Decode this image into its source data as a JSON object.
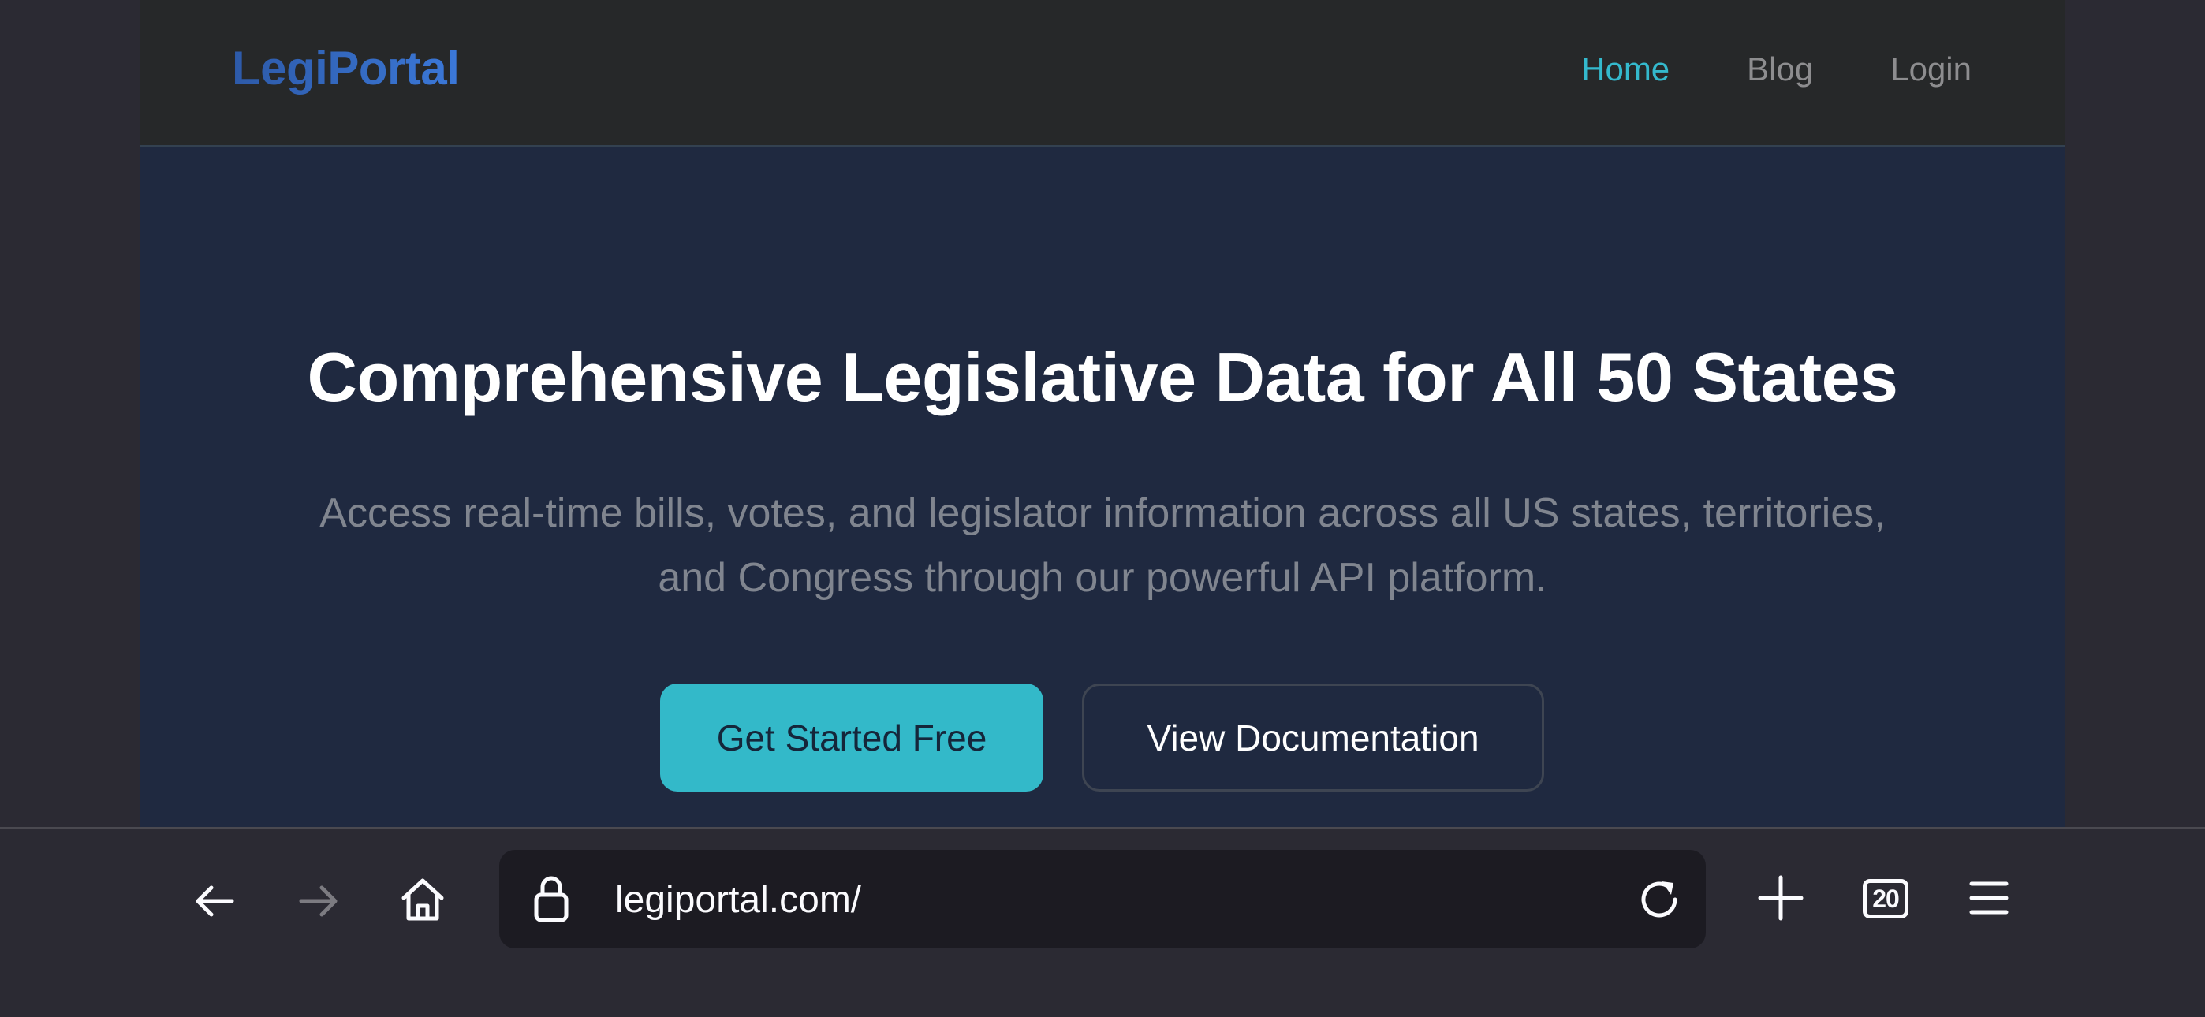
{
  "site": {
    "logo": "LegiPortal",
    "nav": [
      {
        "label": "Home",
        "active": true
      },
      {
        "label": "Blog",
        "active": false
      },
      {
        "label": "Login",
        "active": false
      }
    ]
  },
  "hero": {
    "title": "Comprehensive Legislative Data for All 50 States",
    "subtitle_line1": "Access real-time bills, votes, and legislator information across all US states, territories,",
    "subtitle_line2": "and Congress through our powerful API platform.",
    "primary_button": "Get Started Free",
    "secondary_button": "View Documentation"
  },
  "browser": {
    "url": "legiportal.com/",
    "tab_count": "20",
    "icons": [
      "back-icon",
      "forward-icon",
      "home-icon",
      "lock-icon",
      "reload-icon",
      "new-tab-icon",
      "tabs-icon",
      "menu-icon"
    ]
  },
  "colors": {
    "page_bg": "#1f2940",
    "navbar_bg": "#262829",
    "accent": "#33b9c9",
    "logo": "#3b78d8",
    "browser_chrome": "#2b2a33",
    "urlbar_bg": "#1c1b22"
  }
}
